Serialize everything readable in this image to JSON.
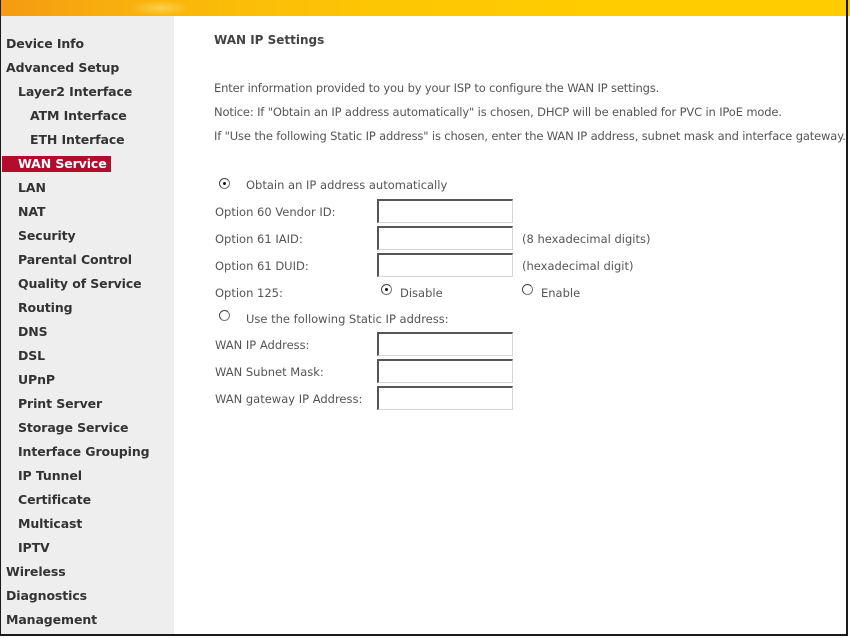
{
  "sidebar": {
    "items": [
      {
        "label": "Device Info",
        "level": 0
      },
      {
        "label": "Advanced Setup",
        "level": 0
      },
      {
        "label": "Layer2 Interface",
        "level": 1
      },
      {
        "label": "ATM Interface",
        "level": 2
      },
      {
        "label": "ETH Interface",
        "level": 2
      },
      {
        "label": "WAN Service",
        "level": 1,
        "active": true
      },
      {
        "label": "LAN",
        "level": 1
      },
      {
        "label": "NAT",
        "level": 1
      },
      {
        "label": "Security",
        "level": 1
      },
      {
        "label": "Parental Control",
        "level": 1
      },
      {
        "label": "Quality of Service",
        "level": 1
      },
      {
        "label": "Routing",
        "level": 1
      },
      {
        "label": "DNS",
        "level": 1
      },
      {
        "label": "DSL",
        "level": 1
      },
      {
        "label": "UPnP",
        "level": 1
      },
      {
        "label": "Print Server",
        "level": 1
      },
      {
        "label": "Storage Service",
        "level": 1
      },
      {
        "label": "Interface Grouping",
        "level": 1
      },
      {
        "label": "IP Tunnel",
        "level": 1
      },
      {
        "label": "Certificate",
        "level": 1
      },
      {
        "label": "Multicast",
        "level": 1
      },
      {
        "label": "IPTV",
        "level": 1
      },
      {
        "label": "Wireless",
        "level": 0
      },
      {
        "label": "Diagnostics",
        "level": 0
      },
      {
        "label": "Management",
        "level": 0
      }
    ]
  },
  "colors": {
    "active_menu_bg": "#b30c2c",
    "banner": "#ffcc00"
  },
  "main": {
    "title": "WAN IP Settings",
    "descriptions": [
      "Enter information provided to you by your ISP to configure the WAN IP settings.",
      "Notice: If \"Obtain an IP address automatically\" is chosen, DHCP will be enabled for PVC in IPoE mode.",
      "If \"Use the following Static IP address\" is chosen, enter the WAN IP address, subnet mask and interface gateway."
    ],
    "auto_ip": {
      "label": "Obtain an IP address automatically",
      "selected": true,
      "option60_label": "Option 60 Vendor ID:",
      "option60_value": "",
      "option61_iaid_label": "Option 61 IAID:",
      "option61_iaid_value": "",
      "option61_iaid_hint": "(8 hexadecimal digits)",
      "option61_duid_label": "Option 61 DUID:",
      "option61_duid_value": "",
      "option61_duid_hint": "(hexadecimal digit)",
      "option125_label": "Option 125:",
      "option125_disable": "Disable",
      "option125_enable": "Enable",
      "option125_selected": "Disable"
    },
    "static_ip": {
      "label": "Use the following Static IP address:",
      "selected": false,
      "wan_ip_label": "WAN IP Address:",
      "wan_ip_value": "",
      "subnet_label": "WAN Subnet Mask:",
      "subnet_value": "",
      "gateway_label": "WAN gateway IP Address:",
      "gateway_value": ""
    }
  }
}
